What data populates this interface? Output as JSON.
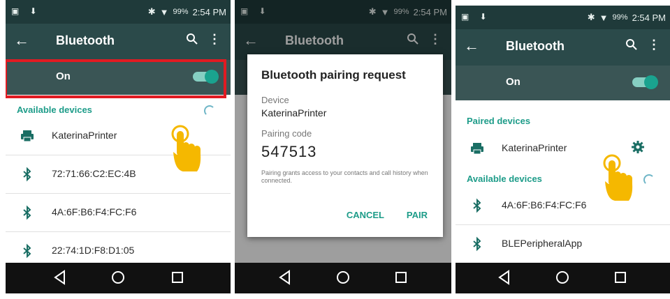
{
  "colors": {
    "accent": "#1d9c89",
    "statusbar": "#1f3a3a",
    "appbar": "#2b4a4a",
    "toggle_row": "#3a5555",
    "highlight": "#e11b22",
    "navbar": "#111111"
  },
  "status": {
    "battery": "99%",
    "time": "2:54 PM"
  },
  "appbar": {
    "title": "Bluetooth",
    "back_icon": "arrow-left-icon",
    "search_icon": "search-icon",
    "more_icon": "more-vert-icon"
  },
  "toggle": {
    "label": "On",
    "state": true
  },
  "screen1": {
    "section": "Available devices",
    "devices": [
      {
        "name": "KaterinaPrinter",
        "icon": "printer-icon"
      },
      {
        "name": "72:71:66:C2:EC:4B",
        "icon": "bluetooth-icon"
      },
      {
        "name": "4A:6F:B6:F4:FC:F6",
        "icon": "bluetooth-icon"
      },
      {
        "name": "22:74:1D:F8:D1:05",
        "icon": "bluetooth-icon"
      }
    ]
  },
  "dialog": {
    "title": "Bluetooth pairing request",
    "device_label": "Device",
    "device_value": "KaterinaPrinter",
    "code_label": "Pairing code",
    "code_value": "547513",
    "note": "Pairing grants access to your contacts and call history when connected.",
    "cancel": "CANCEL",
    "pair": "PAIR"
  },
  "screen3": {
    "paired_section": "Paired devices",
    "paired": [
      {
        "name": "KaterinaPrinter",
        "icon": "printer-icon"
      }
    ],
    "available_section": "Available devices",
    "available": [
      {
        "name": "4A:6F:B6:F4:FC:F6",
        "icon": "bluetooth-icon"
      },
      {
        "name": "BLEPeripheralApp",
        "icon": "bluetooth-icon"
      }
    ]
  }
}
